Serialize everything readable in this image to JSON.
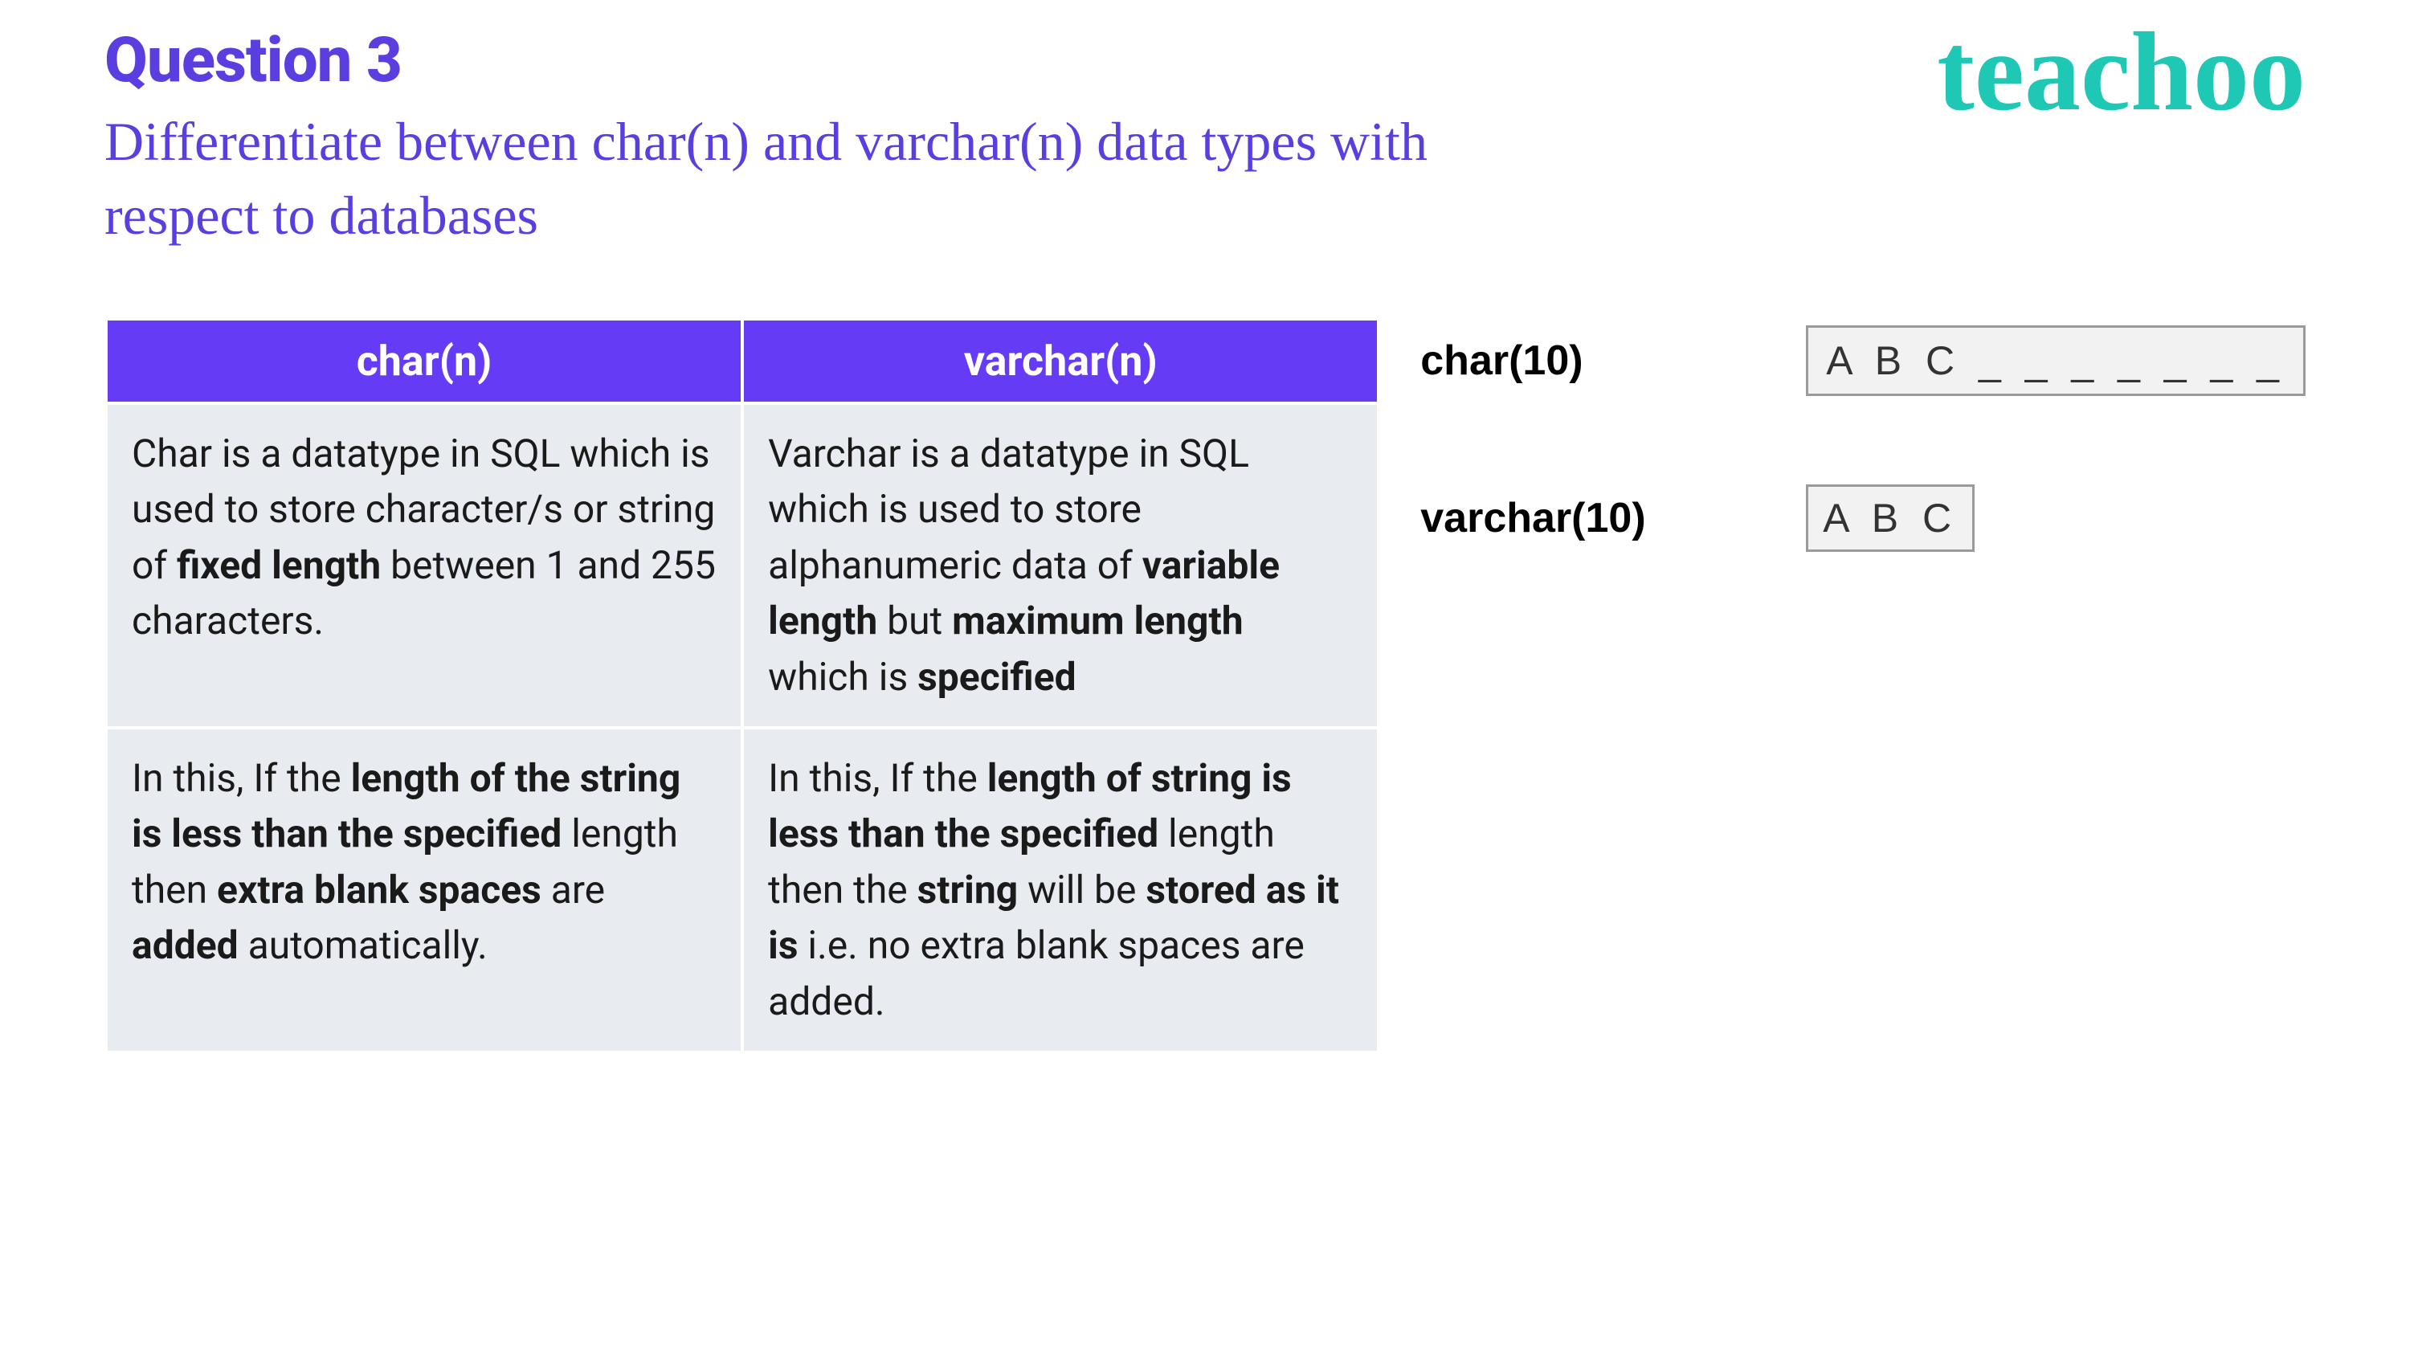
{
  "header": {
    "question_label": "Question 3",
    "question_text": "Differentiate between char(n) and varchar(n) data types with respect to databases",
    "logo_text": "teachoo"
  },
  "table": {
    "headers": [
      "char(n)",
      "varchar(n)"
    ],
    "rows": [
      {
        "char": "Char is a datatype in SQL which is used to store character/s or string of <b>fixed length</b> between 1 and 255 characters.",
        "varchar": "Varchar is a datatype in SQL which is used to store alphanumeric data of <b>variable length</b> but <b>maximum length</b> which is <b>specified</b>"
      },
      {
        "char": "In this, If the <b>length of the string is less than the specified</b> length then <b>extra blank spaces</b> are <b>added</b> automatically.",
        "varchar": "In this, If the <b>length of string is less than the specified</b> length then the <b>string</b> will be <b>stored as it is</b> i.e. no extra blank spaces are added."
      }
    ]
  },
  "examples": {
    "char_label": "char(10)",
    "char_box": "A B C _ _ _ _ _ _ _",
    "varchar_label": "varchar(10)",
    "varchar_box": "A B C"
  }
}
